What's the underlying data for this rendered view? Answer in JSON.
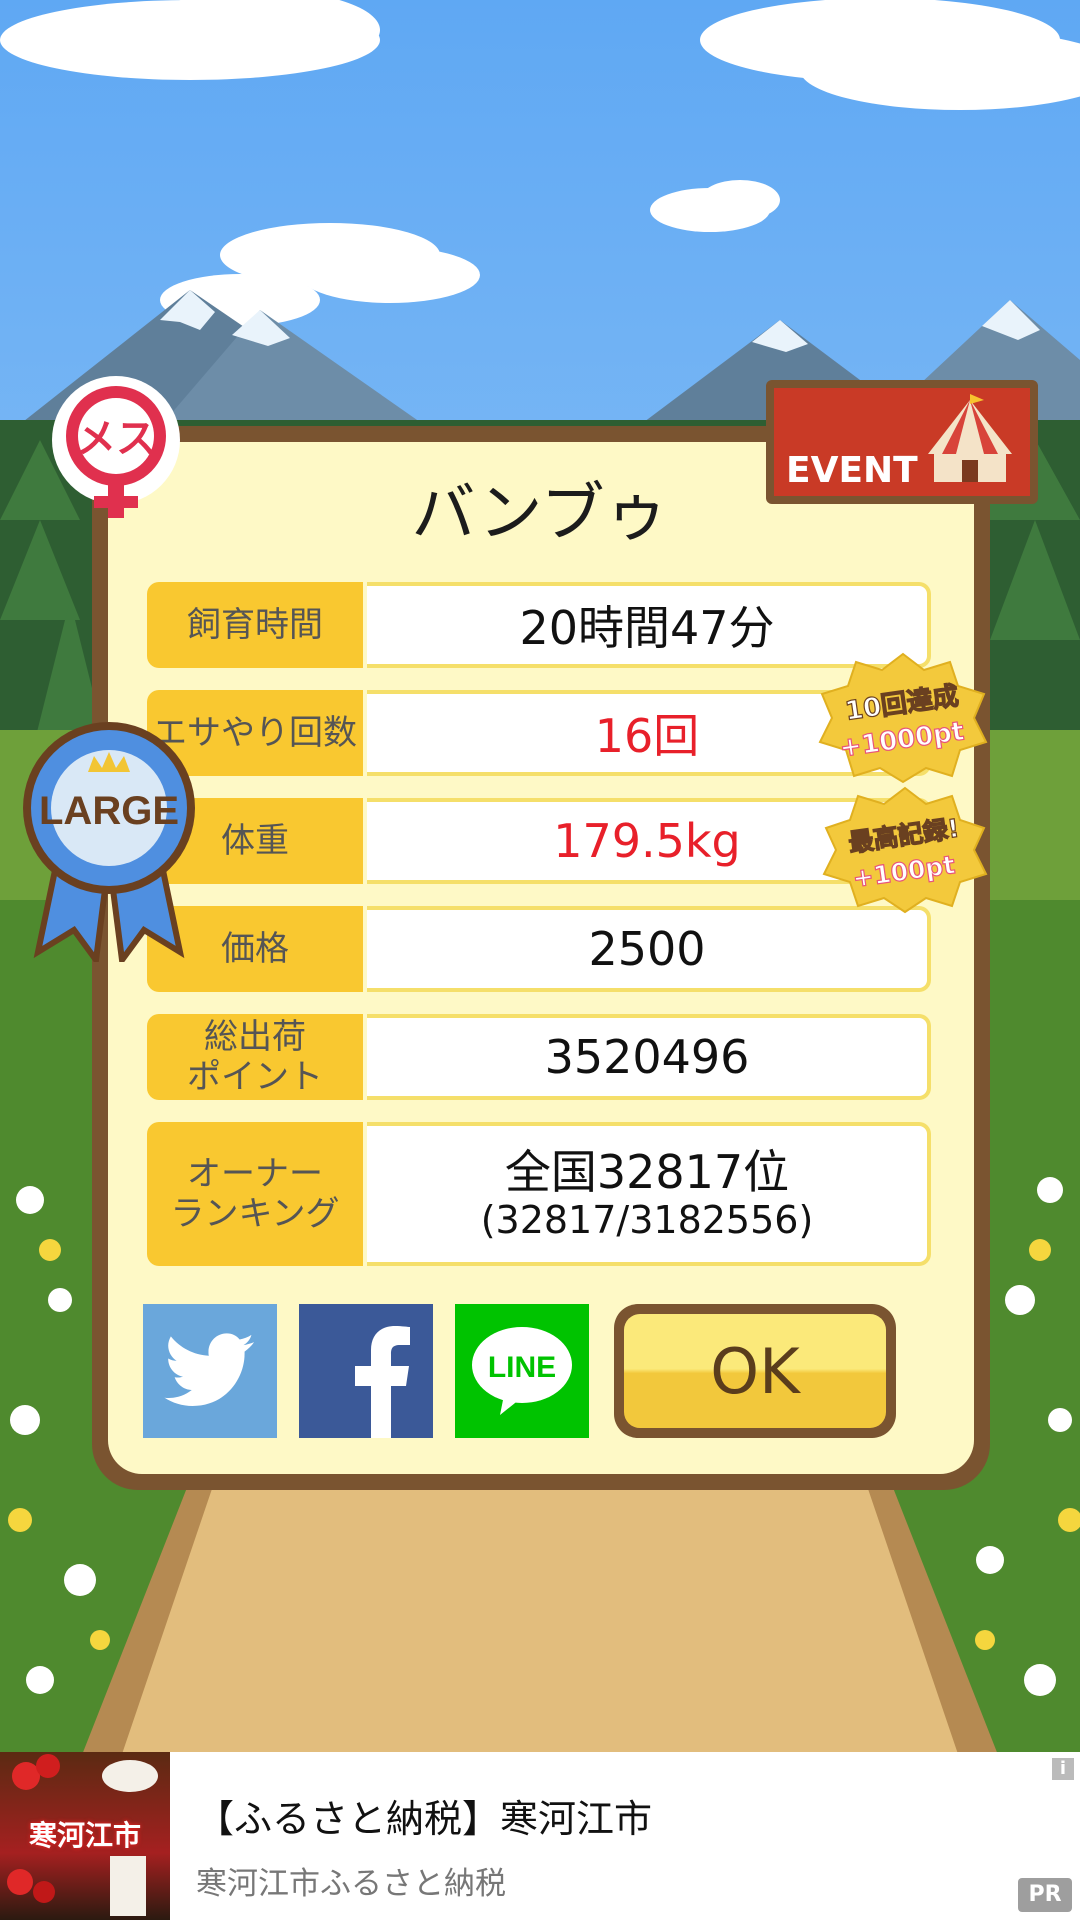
{
  "pig": {
    "name": "バンブゥ",
    "gender_label": "メス",
    "size_ribbon": "LARGE",
    "event_badge": "EVENT"
  },
  "stats": {
    "rows": [
      {
        "label": "飼育時間",
        "value": "20時間47分",
        "highlight": false
      },
      {
        "label": "エサやり回数",
        "value": "16回",
        "highlight": true
      },
      {
        "label": "体重",
        "value": "179.5kg",
        "highlight": true
      },
      {
        "label": "価格",
        "value": "2500",
        "highlight": false
      },
      {
        "label": "総出荷\nポイント",
        "value": "3520496",
        "highlight": false
      }
    ],
    "ranking": {
      "label": "オーナー\nランキング",
      "main": "全国32817位",
      "sub": "(32817/3182556)"
    }
  },
  "bonus": [
    {
      "line1": "10回達成",
      "line2": "+1000pt"
    },
    {
      "line1": "最高記録!",
      "line2": "+100pt"
    }
  ],
  "social": {
    "twitter_color": "#6aa7db",
    "facebook_color": "#3b5998",
    "line_label": "LINE",
    "line_color": "#00c300"
  },
  "ok_label": "OK",
  "ad": {
    "title": "【ふるさと納税】寒河江市",
    "subtitle": "寒河江市ふるさと納税",
    "thumb_text": "寒河江市",
    "info": "i",
    "pr": "PR"
  }
}
